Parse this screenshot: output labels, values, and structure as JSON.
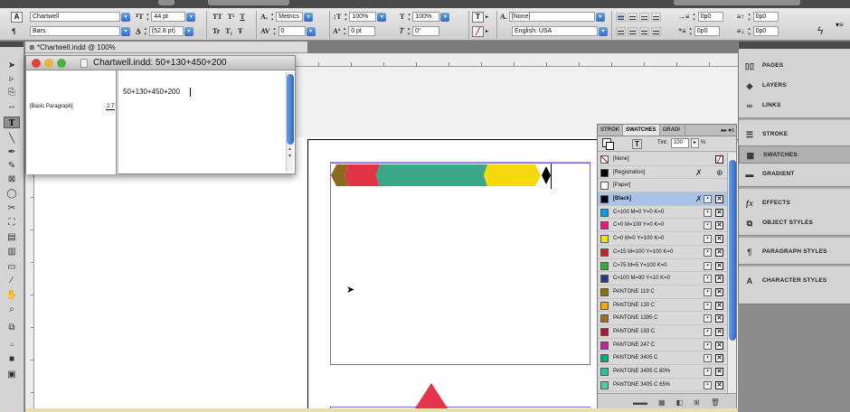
{
  "control": {
    "font_family": "Chartwell",
    "font_style": "Bars",
    "font_size": "44 pt",
    "leading": "(52.8 pt)",
    "kerning": "Metrics",
    "tracking": "0",
    "vscale": "100%",
    "hscale": "100%",
    "baseline": "0 pt",
    "skew": "0°",
    "char_style": "[None]",
    "language": "English: USA",
    "indent_left": "0p0",
    "indent_right": "0p0",
    "first_line": "0p0",
    "last_line": "0p0",
    "space_before": "0p0",
    "space_after": "0p0",
    "tt": "TT",
    "ts": "T¹",
    "t_under": "T",
    "tr": "Tr",
    "t_sub": "T₁",
    "t_strike": "Ŧ",
    "char_a": "A."
  },
  "document": {
    "tab_title": "*Chartwell.indd @ 100%"
  },
  "story_editor": {
    "title": "Chartwell.indd: 50+130+450+200",
    "paragraph_style": "[Basic Paragraph]",
    "depth": "2.7",
    "text": "50+130+450+200"
  },
  "chart_data": {
    "type": "bar",
    "categories": [
      "50",
      "130",
      "450",
      "200"
    ],
    "values": [
      50,
      130,
      450,
      200
    ],
    "colors": [
      "#8b6a1d",
      "#e03344",
      "#3aa886",
      "#f5d90a"
    ]
  },
  "swatches_panel": {
    "tabs": [
      "STROK",
      "SWATCHES",
      "GRADI"
    ],
    "tint_label": "Tint:",
    "tint_value": "100",
    "tint_unit": "%",
    "swatches": [
      {
        "name": "[None]",
        "color": "none"
      },
      {
        "name": "[Registration]",
        "color": "#000000"
      },
      {
        "name": "[Paper]",
        "color": "#ffffff"
      },
      {
        "name": "[Black]",
        "color": "#000000",
        "selected": true
      },
      {
        "name": "C=100 M=0 Y=0 K=0",
        "color": "#0a9ee0"
      },
      {
        "name": "C=0 M=100 Y=0 K=0",
        "color": "#e5197e"
      },
      {
        "name": "C=0 M=0 Y=100 K=0",
        "color": "#f9e600"
      },
      {
        "name": "C=15 M=100 Y=100 K=0",
        "color": "#c41e26"
      },
      {
        "name": "C=75 M=5 Y=100 K=0",
        "color": "#3aa53b"
      },
      {
        "name": "C=100 M=90 Y=10 K=0",
        "color": "#253a8e"
      },
      {
        "name": "PANTONE 119 C",
        "color": "#8a7012"
      },
      {
        "name": "PANTONE 130 C",
        "color": "#f2a900"
      },
      {
        "name": "PANTONE 1395 C",
        "color": "#9c6d1e"
      },
      {
        "name": "PANTONE 193 C",
        "color": "#bf0d3e"
      },
      {
        "name": "PANTONE 247 C",
        "color": "#b5299a"
      },
      {
        "name": "PANTONE 3405 C",
        "color": "#00ab84"
      },
      {
        "name": "PANTONE 3405 C 80%",
        "color": "#33bc9d"
      },
      {
        "name": "PANTONE 3405 C 65%",
        "color": "#59c9ae"
      }
    ]
  },
  "dock": {
    "items": [
      "PAGES",
      "LAYERS",
      "LINKS",
      "STROKE",
      "SWATCHES",
      "GRADIENT",
      "EFFECTS",
      "OBJECT STYLES",
      "PARAGRAPH STYLES",
      "CHARACTER STYLES"
    ]
  }
}
